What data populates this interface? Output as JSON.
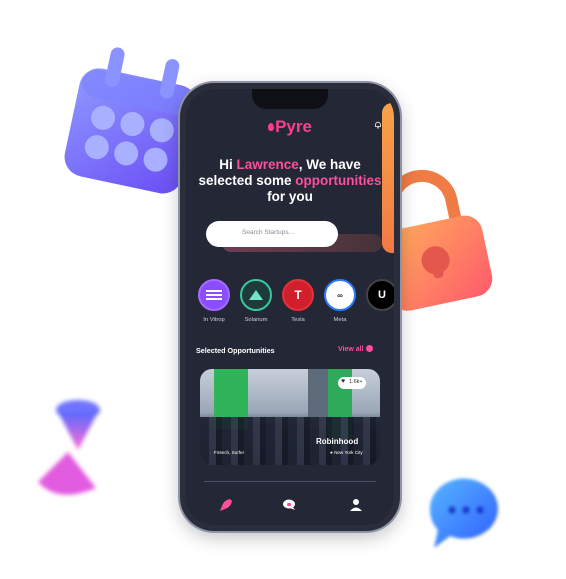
{
  "app": {
    "logo": "Pyre"
  },
  "greeting": {
    "line1_prefix": "Hi ",
    "name": "Lawrence",
    "line1_suffix": ", We have",
    "line2_prefix": "selected some ",
    "highlight": "opportunities",
    "line3": "for you"
  },
  "search": {
    "placeholder": "Search Startups..."
  },
  "startups": [
    {
      "label": "In Vitrop",
      "icon": "invitrop-logo",
      "ring": "#a86bff"
    },
    {
      "label": "Solarium",
      "icon": "solarium-logo",
      "ring": "#38c9a0"
    },
    {
      "label": "Tesla",
      "icon": "tesla-logo",
      "ring": "#e4313b"
    },
    {
      "label": "Meta",
      "icon": "meta-logo",
      "ring": "#2f7bff"
    },
    {
      "label": "U",
      "icon": "u-logo",
      "ring": "#111111"
    }
  ],
  "section": {
    "title": "Selected Opportunities",
    "view_all": "View all"
  },
  "card": {
    "company": "Robinhood",
    "location": "New York City",
    "meta": "Fintech, Surfer",
    "likes": "1.6k+"
  },
  "colors": {
    "accent": "#ff4e9c",
    "background": "#242735"
  }
}
